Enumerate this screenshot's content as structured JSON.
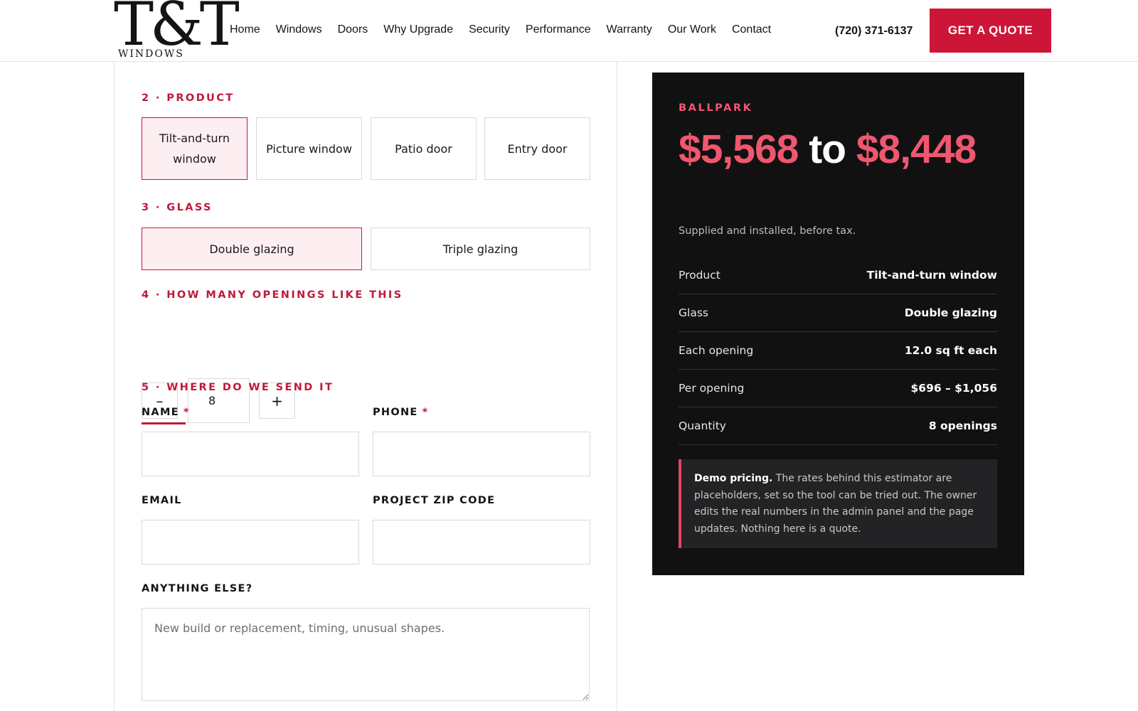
{
  "header": {
    "logo_mark": "T&T",
    "logo_sub": "WINDOWS",
    "nav": [
      "Home",
      "Windows",
      "Doors",
      "Why Upgrade",
      "Security",
      "Performance",
      "Warranty",
      "Our Work",
      "Contact"
    ],
    "phone": "(720) 371-6137",
    "cta": "GET A QUOTE"
  },
  "form": {
    "product": {
      "label": "2 · PRODUCT",
      "options": [
        "Tilt-and-turn window",
        "Picture window",
        "Patio door",
        "Entry door"
      ],
      "selected": "Tilt-and-turn window"
    },
    "glass": {
      "label": "3 · GLASS",
      "options": [
        "Double glazing",
        "Triple glazing"
      ],
      "selected": "Double glazing"
    },
    "quantity": {
      "label": "4 · HOW MANY OPENINGS LIKE THIS",
      "minus": "–",
      "plus": "+",
      "value": "8"
    },
    "contact": {
      "label": "5 · WHERE DO WE SEND IT",
      "name_label": "NAME",
      "phone_label": "PHONE",
      "required_mark": "*",
      "email_label": "EMAIL",
      "zip_label": "PROJECT ZIP CODE",
      "notes_label": "ANYTHING ELSE?",
      "notes_placeholder": "New build or replacement, timing, unusual shapes.",
      "name_value": "",
      "phone_value": "",
      "email_value": "",
      "zip_value": ""
    }
  },
  "estimate": {
    "kicker": "BALLPARK",
    "price_low": "$5,568",
    "price_to": "to",
    "price_high": "$8,448",
    "note": "Supplied and installed, before tax.",
    "rows": [
      {
        "key": "Product",
        "value": "Tilt-and-turn window"
      },
      {
        "key": "Glass",
        "value": "Double glazing"
      },
      {
        "key": "Each opening",
        "value": "12.0 sq ft each"
      },
      {
        "key": "Per opening",
        "value": "$696 – $1,056"
      },
      {
        "key": "Quantity",
        "value": "8 openings"
      }
    ],
    "disclaimer_bold": "Demo pricing.",
    "disclaimer_text": "The rates behind this estimator are placeholders, set so the tool can be tried out. The owner edits the real numbers in the admin panel and the page updates. Nothing here is a quote."
  },
  "colors": {
    "accent": "#cd1537",
    "accent_light": "#f0576f",
    "panel_bg": "#111112"
  }
}
